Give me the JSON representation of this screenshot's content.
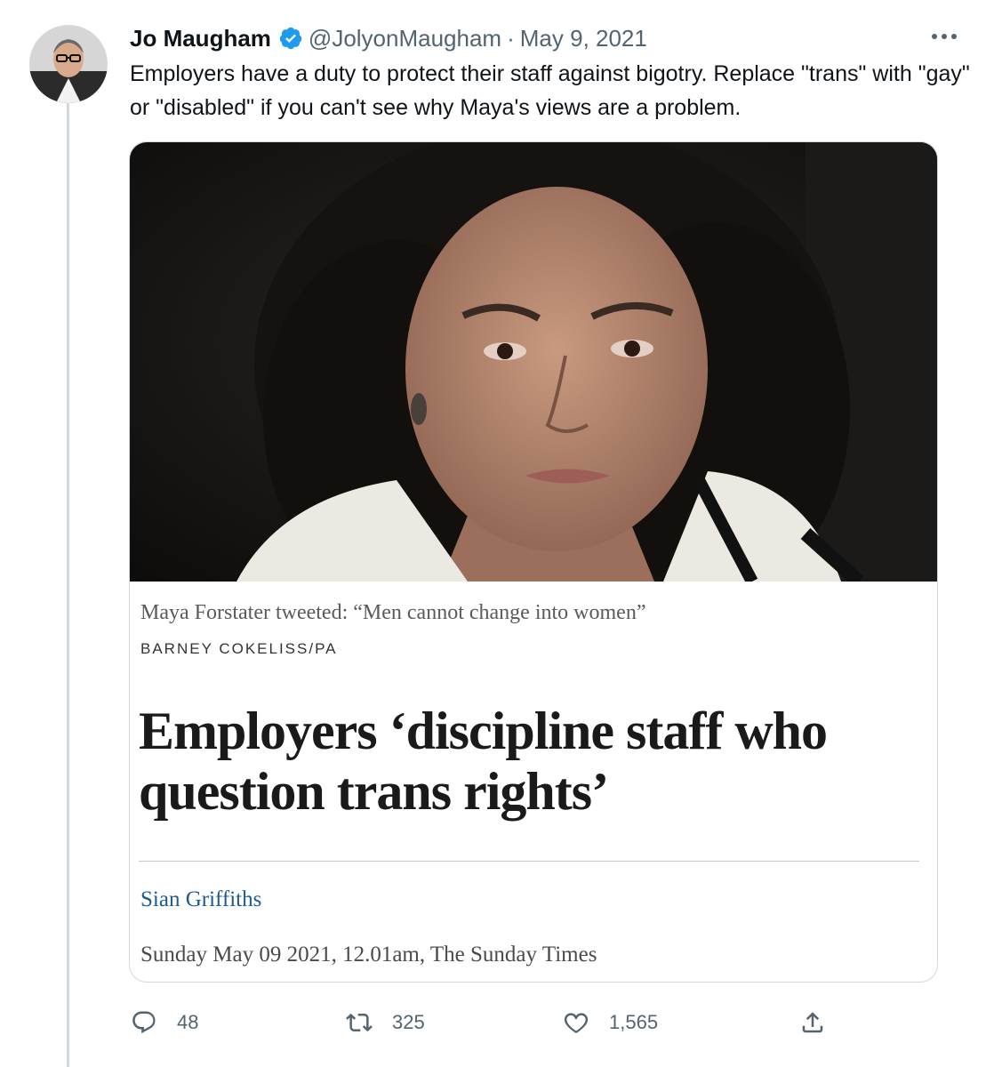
{
  "author": {
    "name": "Jo Maugham",
    "handle": "@JolyonMaugham",
    "separator": "·",
    "date": "May 9, 2021"
  },
  "tweet": {
    "text": "Employers have a duty to protect their staff against bigotry. Replace \"trans\" with \"gay\" or \"disabled\" if you can't see why Maya's views are a problem."
  },
  "card": {
    "caption": "Maya Forstater tweeted: “Men cannot change into women”",
    "credit": "BARNEY COKELISS/PA",
    "headline": "Employers ‘discipline staff who question trans rights’",
    "byline": "Sian Griffiths",
    "dateline": "Sunday May 09 2021, 12.01am, The Sunday Times"
  },
  "actions": {
    "replies": "48",
    "retweets": "325",
    "likes": "1,565"
  },
  "icons": {
    "verified": "verified-badge-icon",
    "more": "more-options-icon",
    "reply": "reply-icon",
    "retweet": "retweet-icon",
    "like": "heart-icon",
    "share": "share-icon"
  },
  "colors": {
    "verified_blue": "#1d9bf0",
    "secondary_text": "#536471",
    "byline_blue": "#1c5a91",
    "border": "#cfd9de"
  }
}
